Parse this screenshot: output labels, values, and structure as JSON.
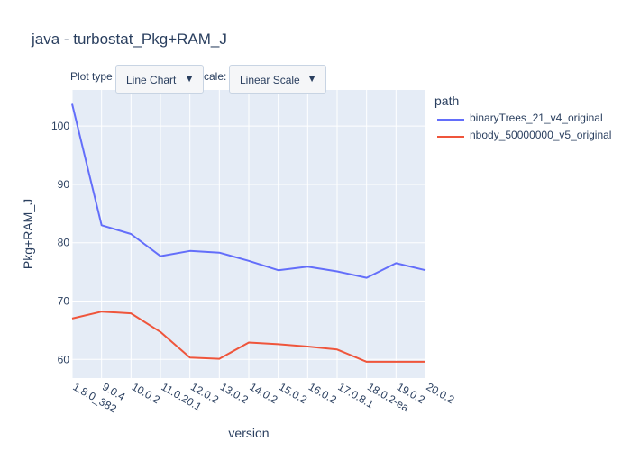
{
  "title": "java - turbostat_Pkg+RAM_J",
  "controls": {
    "plot_type_label": "Plot type",
    "plot_type_value": "Line Chart",
    "scale_label": "cale:",
    "scale_value": "Linear Scale",
    "dropdown_icon": "triangle-down-icon"
  },
  "legend": {
    "title": "path",
    "colors": [
      "#636efa",
      "#ef553b"
    ]
  },
  "chart_data": {
    "type": "line",
    "xlabel": "version",
    "ylabel": "Pkg+RAM_J",
    "categories": [
      "1.8.0_382",
      "9.0.4",
      "10.0.2",
      "11.0.20.1",
      "12.0.2",
      "13.0.2",
      "14.0.2",
      "15.0.2",
      "16.0.2",
      "17.0.8.1",
      "18.0.2-ea",
      "19.0.2",
      "20.0.2"
    ],
    "yticks": [
      60,
      70,
      80,
      90,
      100
    ],
    "ylim": [
      56.8,
      106.2
    ],
    "grid": true,
    "legend_position": "top-right",
    "series": [
      {
        "name": "binaryTrees_21_v4_original",
        "color": "#636efa",
        "values": [
          103.8,
          83.0,
          81.5,
          77.7,
          78.6,
          78.3,
          76.9,
          75.3,
          75.9,
          75.1,
          74.0,
          76.5,
          75.3
        ]
      },
      {
        "name": "nbody_50000000_v5_original",
        "color": "#ef553b",
        "values": [
          67.0,
          68.2,
          67.9,
          64.7,
          60.3,
          60.1,
          62.9,
          62.6,
          62.2,
          61.7,
          59.6,
          59.6,
          59.6
        ]
      }
    ]
  }
}
